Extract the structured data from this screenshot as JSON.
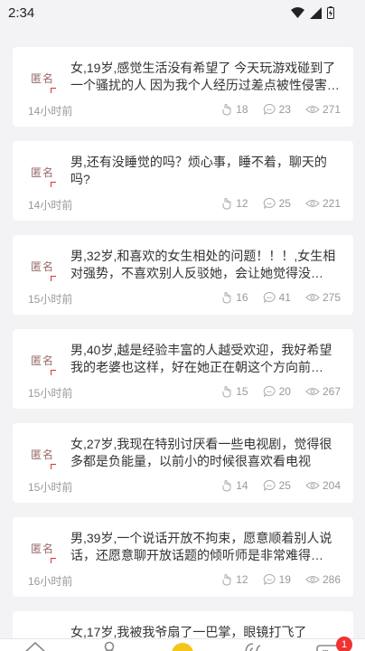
{
  "status_bar": {
    "time": "2:34"
  },
  "posts": [
    {
      "avatar_label": "匿名",
      "text": "女,19岁,感觉生活没有希望了 今天玩游戏碰到了一个骚扰的人 因为我个人经历过差点被性侵害的…",
      "time_ago": "14小时前",
      "likes": "18",
      "comments": "23",
      "views": "271"
    },
    {
      "avatar_label": "匿名",
      "text": "男,还有没睡觉的吗？烦心事，睡不着，聊天的吗?",
      "time_ago": "14小时前",
      "likes": "12",
      "comments": "25",
      "views": "221"
    },
    {
      "avatar_label": "匿名",
      "text": "男,32岁,和喜欢的女生相处的问题！！！,女生相对强势，不喜欢别人反驳她，会让她觉得没…",
      "time_ago": "15小时前",
      "likes": "16",
      "comments": "41",
      "views": "275"
    },
    {
      "avatar_label": "匿名",
      "text": "男,40岁,越是经验丰富的人越受欢迎，我好希望我的老婆也这样，好在她正在朝这个方向前…",
      "time_ago": "15小时前",
      "likes": "15",
      "comments": "20",
      "views": "267"
    },
    {
      "avatar_label": "匿名",
      "text": "女,27岁,我现在特别讨厌看一些电视剧，觉得很多都是负能量，以前小的时候很喜欢看电视",
      "time_ago": "15小时前",
      "likes": "14",
      "comments": "25",
      "views": "204"
    },
    {
      "avatar_label": "匿名",
      "text": "男,39岁,一个说话开放不拘束，愿意顺着别人说话，还愿意聊开放话题的倾听师是非常难得…",
      "time_ago": "16小时前",
      "likes": "12",
      "comments": "19",
      "views": "286"
    },
    {
      "avatar_label": "匿名",
      "text": "女,17岁,我被我爷扇了一巴掌，眼镜打飞了",
      "time_ago": "",
      "likes": "",
      "comments": "",
      "views": ""
    }
  ],
  "nav": {
    "badge": "1"
  },
  "colors": {
    "accent": "#f5c518",
    "badge": "#e33333"
  }
}
